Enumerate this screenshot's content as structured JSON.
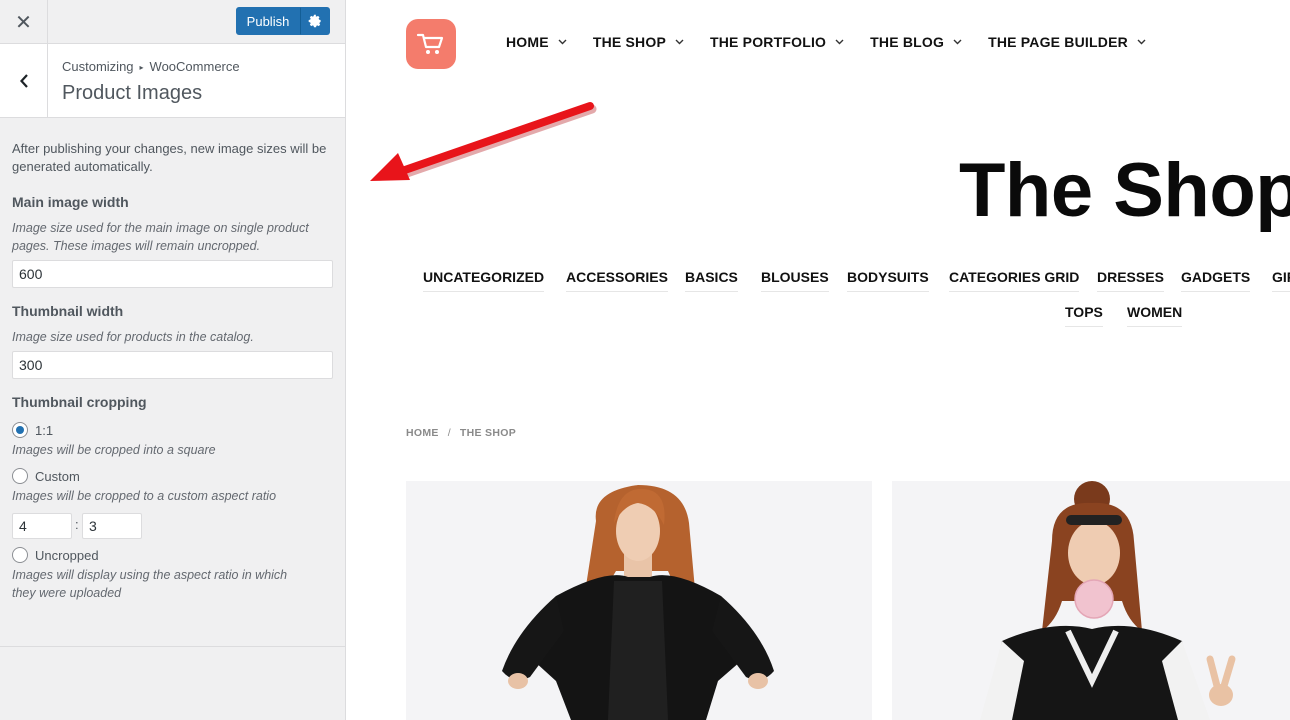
{
  "customizer": {
    "close_glyph": "✕",
    "publish_label": "Publish",
    "breadcrumb": {
      "root": "Customizing",
      "separator": "▸",
      "panel": "WooCommerce"
    },
    "section_title": "Product Images",
    "notice": "After publishing your changes, new image sizes will be generated automatically.",
    "main_image": {
      "label": "Main image width",
      "description": "Image size used for the main image on single product pages. These images will remain uncropped.",
      "value": "600"
    },
    "thumbnail": {
      "label": "Thumbnail width",
      "description": "Image size used for products in the catalog.",
      "value": "300"
    },
    "cropping": {
      "label": "Thumbnail cropping",
      "options": [
        {
          "label": "1:1",
          "description": "Images will be cropped into a square",
          "checked": true
        },
        {
          "label": "Custom",
          "description": "Images will be cropped to a custom aspect ratio",
          "checked": false
        },
        {
          "label": "Uncropped",
          "description": "Images will display using the aspect ratio in which they were uploaded",
          "checked": false
        }
      ],
      "ratio_width": "4",
      "ratio_separator": ":",
      "ratio_height": "3"
    }
  },
  "preview": {
    "nav": [
      "HOME",
      "THE SHOP",
      "THE PORTFOLIO",
      "THE BLOG",
      "THE PAGE BUILDER"
    ],
    "page_title": "The Shop",
    "categories": [
      "UNCATEGORIZED",
      "ACCESSORIES",
      "BASICS",
      "BLOUSES",
      "BODYSUITS",
      "CATEGORIES GRID",
      "DRESSES",
      "GADGETS",
      "GIFTS",
      "TOPS",
      "WOMEN"
    ],
    "breadcrumb": {
      "home": "HOME",
      "separator": "/",
      "current": "THE SHOP"
    },
    "colors": {
      "logo": "#f47c6c",
      "annotation_arrow": "#e8141a",
      "publish": "#2271b1"
    }
  }
}
